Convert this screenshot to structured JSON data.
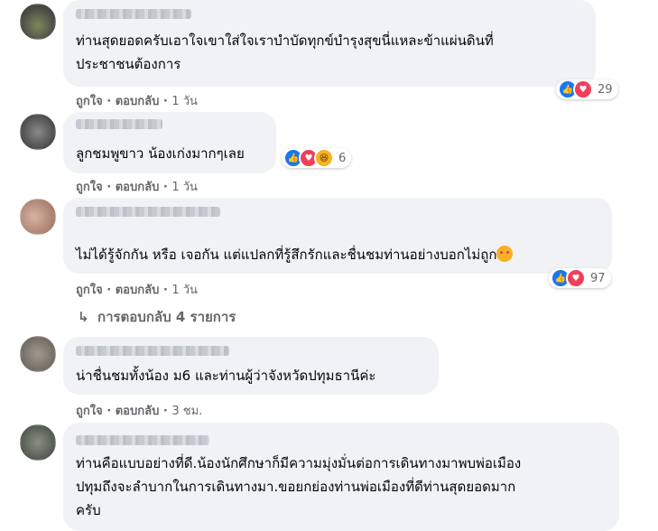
{
  "comments": [
    {
      "text_lines": [
        "ท่านสุดยอดครับเอาใจเขาใส่ใจเราบำบัดทุกข์บำรุงสุขนี่แหละข้าแผ่นดินที่",
        "ประชาชนต้องการ"
      ],
      "like_label": "ถูกใจ",
      "reply_label": "ตอบกลับ",
      "time": "1 วัน",
      "reaction_count": "29",
      "reactions": [
        "like",
        "love"
      ]
    },
    {
      "text_lines": [
        "ลูกชมพูขาว น้องเก่งมากๆเลย"
      ],
      "like_label": "ถูกใจ",
      "reply_label": "ตอบกลับ",
      "time": "1 วัน",
      "reaction_count": "6",
      "reactions": [
        "like",
        "love",
        "haha"
      ]
    },
    {
      "text_lines": [
        "ไม่ได้รู้จักกัน หรือ เจอกัน แต่แปลกที่รู้สึกรักและชื่นชมท่านอย่างบอกไม่ถูก"
      ],
      "like_label": "ถูกใจ",
      "reply_label": "ตอบกลับ",
      "time": "1 วัน",
      "reaction_count": "97",
      "reactions": [
        "like",
        "love"
      ],
      "replies_label": "การตอบกลับ 4 รายการ"
    },
    {
      "text_lines": [
        "น่าชื่นชมทั้งน้อง ม6 และท่านผู้ว่าจังหวัดปทุมธานีค่ะ"
      ],
      "like_label": "ถูกใจ",
      "reply_label": "ตอบกลับ",
      "time": "3 ชม."
    },
    {
      "text_lines": [
        "ท่านคือแบบอย่างที่ดี.น้องนักศึกษาก็มีความมุ่งมั่นต่อการเดินทางมาพบพ่อเมือง",
        "ปทุมถึงจะลำบากในการเดินทางมา.ขอยกย่องท่านพ่อเมืองที่ดีท่านสุดยอดมาก",
        "ครับ"
      ]
    }
  ],
  "separator": "·",
  "icons": {
    "reply_arrow": "reply-arrow-icon",
    "emoji": "smiling-face-with-hearts-icon"
  },
  "colors": {
    "bubble": "#f0f2f5",
    "meta_text": "#65676b",
    "like": "#1877f2",
    "love": "#f33e58",
    "haha": "#f7b125"
  }
}
